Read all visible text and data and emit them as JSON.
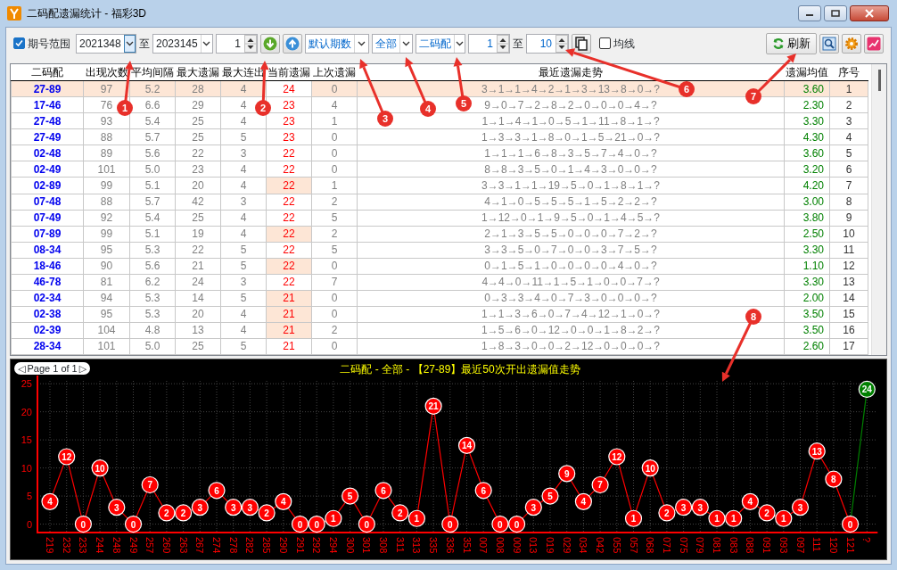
{
  "window": {
    "title": "二码配遗漏统计 - 福彩3D"
  },
  "toolbar": {
    "range_checkbox": {
      "label": "期号范围",
      "checked": true
    },
    "from_issue": "2021348",
    "to_label": "至",
    "to_issue": "2023145",
    "step": "1",
    "period_mode": "默认期数",
    "filter": "全部",
    "group": "二码配",
    "range_from": "1",
    "range_to_label": "至",
    "range_to": "10",
    "avg_line_checkbox": {
      "label": "均线",
      "checked": false
    },
    "refresh_button": "刷新"
  },
  "table": {
    "columns": [
      "二码配",
      "出现次数",
      "平均间隔",
      "最大遗漏",
      "最大连出",
      "当前遗漏",
      "上次遗漏",
      "最近遗漏走势",
      "遗漏均值",
      "序号"
    ],
    "rows": [
      {
        "pair": "27-89",
        "count": "97",
        "avg_interval": "5.2",
        "max_miss": "28",
        "max_streak": "4",
        "current_miss": "24",
        "last_miss": "0",
        "trend": "3→1→1→4→2→1→3→13→8→0→?",
        "miss_avg": "3.60",
        "index": "1",
        "selected": true,
        "highlighted": false
      },
      {
        "pair": "17-46",
        "count": "76",
        "avg_interval": "6.6",
        "max_miss": "29",
        "max_streak": "4",
        "current_miss": "23",
        "last_miss": "4",
        "trend": "9→0→7→2→8→2→0→0→0→4→?",
        "miss_avg": "2.30",
        "index": "2",
        "selected": false,
        "highlighted": false
      },
      {
        "pair": "27-48",
        "count": "93",
        "avg_interval": "5.4",
        "max_miss": "25",
        "max_streak": "4",
        "current_miss": "23",
        "last_miss": "1",
        "trend": "1→1→4→1→0→5→1→11→8→1→?",
        "miss_avg": "3.30",
        "index": "3",
        "selected": false,
        "highlighted": false
      },
      {
        "pair": "27-49",
        "count": "88",
        "avg_interval": "5.7",
        "max_miss": "25",
        "max_streak": "5",
        "current_miss": "23",
        "last_miss": "0",
        "trend": "1→3→3→1→8→0→1→5→21→0→?",
        "miss_avg": "4.30",
        "index": "4",
        "selected": false,
        "highlighted": false
      },
      {
        "pair": "02-48",
        "count": "89",
        "avg_interval": "5.6",
        "max_miss": "22",
        "max_streak": "3",
        "current_miss": "22",
        "last_miss": "0",
        "trend": "1→1→1→6→8→3→5→7→4→0→?",
        "miss_avg": "3.60",
        "index": "5",
        "selected": false,
        "highlighted": false
      },
      {
        "pair": "02-49",
        "count": "101",
        "avg_interval": "5.0",
        "max_miss": "23",
        "max_streak": "4",
        "current_miss": "22",
        "last_miss": "0",
        "trend": "8→8→3→5→0→1→4→3→0→0→?",
        "miss_avg": "3.20",
        "index": "6",
        "selected": false,
        "highlighted": false
      },
      {
        "pair": "02-89",
        "count": "99",
        "avg_interval": "5.1",
        "max_miss": "20",
        "max_streak": "4",
        "current_miss": "22",
        "last_miss": "1",
        "trend": "3→3→1→1→19→5→0→1→8→1→?",
        "miss_avg": "4.20",
        "index": "7",
        "selected": false,
        "highlighted": true
      },
      {
        "pair": "07-48",
        "count": "88",
        "avg_interval": "5.7",
        "max_miss": "42",
        "max_streak": "3",
        "current_miss": "22",
        "last_miss": "2",
        "trend": "4→1→0→5→5→5→1→5→2→2→?",
        "miss_avg": "3.00",
        "index": "8",
        "selected": false,
        "highlighted": false
      },
      {
        "pair": "07-49",
        "count": "92",
        "avg_interval": "5.4",
        "max_miss": "25",
        "max_streak": "4",
        "current_miss": "22",
        "last_miss": "5",
        "trend": "1→12→0→1→9→5→0→1→4→5→?",
        "miss_avg": "3.80",
        "index": "9",
        "selected": false,
        "highlighted": false
      },
      {
        "pair": "07-89",
        "count": "99",
        "avg_interval": "5.1",
        "max_miss": "19",
        "max_streak": "4",
        "current_miss": "22",
        "last_miss": "2",
        "trend": "2→1→3→5→5→0→0→0→7→2→?",
        "miss_avg": "2.50",
        "index": "10",
        "selected": false,
        "highlighted": true
      },
      {
        "pair": "08-34",
        "count": "95",
        "avg_interval": "5.3",
        "max_miss": "22",
        "max_streak": "5",
        "current_miss": "22",
        "last_miss": "5",
        "trend": "3→3→5→0→7→0→0→3→7→5→?",
        "miss_avg": "3.30",
        "index": "11",
        "selected": false,
        "highlighted": false
      },
      {
        "pair": "18-46",
        "count": "90",
        "avg_interval": "5.6",
        "max_miss": "21",
        "max_streak": "5",
        "current_miss": "22",
        "last_miss": "0",
        "trend": "0→1→5→1→0→0→0→0→4→0→?",
        "miss_avg": "1.10",
        "index": "12",
        "selected": false,
        "highlighted": true
      },
      {
        "pair": "46-78",
        "count": "81",
        "avg_interval": "6.2",
        "max_miss": "24",
        "max_streak": "3",
        "current_miss": "22",
        "last_miss": "7",
        "trend": "4→4→0→11→1→5→1→0→0→7→?",
        "miss_avg": "3.30",
        "index": "13",
        "selected": false,
        "highlighted": false
      },
      {
        "pair": "02-34",
        "count": "94",
        "avg_interval": "5.3",
        "max_miss": "14",
        "max_streak": "5",
        "current_miss": "21",
        "last_miss": "0",
        "trend": "0→3→3→4→0→7→3→0→0→0→?",
        "miss_avg": "2.00",
        "index": "14",
        "selected": false,
        "highlighted": true
      },
      {
        "pair": "02-38",
        "count": "95",
        "avg_interval": "5.3",
        "max_miss": "20",
        "max_streak": "4",
        "current_miss": "21",
        "last_miss": "0",
        "trend": "1→1→3→6→0→7→4→12→1→0→?",
        "miss_avg": "3.50",
        "index": "15",
        "selected": false,
        "highlighted": true
      },
      {
        "pair": "02-39",
        "count": "104",
        "avg_interval": "4.8",
        "max_miss": "13",
        "max_streak": "4",
        "current_miss": "21",
        "last_miss": "2",
        "trend": "1→5→6→0→12→0→0→1→8→2→?",
        "miss_avg": "3.50",
        "index": "16",
        "selected": false,
        "highlighted": true
      },
      {
        "pair": "28-34",
        "count": "101",
        "avg_interval": "5.0",
        "max_miss": "25",
        "max_streak": "5",
        "current_miss": "21",
        "last_miss": "0",
        "trend": "1→8→3→0→0→2→12→0→0→0→?",
        "miss_avg": "2.60",
        "index": "17",
        "selected": false,
        "highlighted": false
      }
    ]
  },
  "chart": {
    "pager": {
      "prev": "◁",
      "label": "Page 1 of 1",
      "next": "▷"
    },
    "chart_data": {
      "type": "line",
      "title": "二码配 - 全部 - 【27-89】最近50次开出遗漏值走势",
      "categories": [
        "219",
        "232",
        "233",
        "244",
        "248",
        "249",
        "257",
        "260",
        "263",
        "267",
        "274",
        "278",
        "282",
        "285",
        "290",
        "291",
        "292",
        "294",
        "300",
        "301",
        "308",
        "311",
        "313",
        "335",
        "336",
        "351",
        "007",
        "008",
        "009",
        "013",
        "019",
        "029",
        "034",
        "042",
        "055",
        "057",
        "068",
        "071",
        "075",
        "079",
        "081",
        "083",
        "088",
        "091",
        "093",
        "097",
        "111",
        "120",
        "121",
        "?"
      ],
      "series": [
        {
          "color": "#ff0000",
          "values": [
            4,
            12,
            0,
            10,
            3,
            0,
            7,
            2,
            2,
            3,
            6,
            3,
            3,
            2,
            4,
            0,
            0,
            1,
            5,
            0,
            6,
            2,
            1,
            21,
            0,
            14,
            6,
            0,
            0,
            3,
            5,
            9,
            4,
            7,
            12,
            1,
            10,
            2,
            3,
            3,
            1,
            1,
            4,
            2,
            1,
            3,
            13,
            8,
            0,
            null
          ]
        },
        {
          "color": "#008000",
          "values": [
            null,
            null,
            null,
            null,
            null,
            null,
            null,
            null,
            null,
            null,
            null,
            null,
            null,
            null,
            null,
            null,
            null,
            null,
            null,
            null,
            null,
            null,
            null,
            null,
            null,
            null,
            null,
            null,
            null,
            null,
            null,
            null,
            null,
            null,
            null,
            null,
            null,
            null,
            null,
            null,
            null,
            null,
            null,
            null,
            null,
            null,
            null,
            null,
            null,
            24
          ]
        }
      ],
      "ylim": [
        -1.5,
        25.5
      ],
      "yticks": [
        0,
        5,
        10,
        15,
        20,
        25
      ],
      "data_labels": true,
      "grid": true,
      "marker": true
    }
  },
  "callouts": [
    "1",
    "2",
    "3",
    "4",
    "5",
    "6",
    "7",
    "8"
  ]
}
